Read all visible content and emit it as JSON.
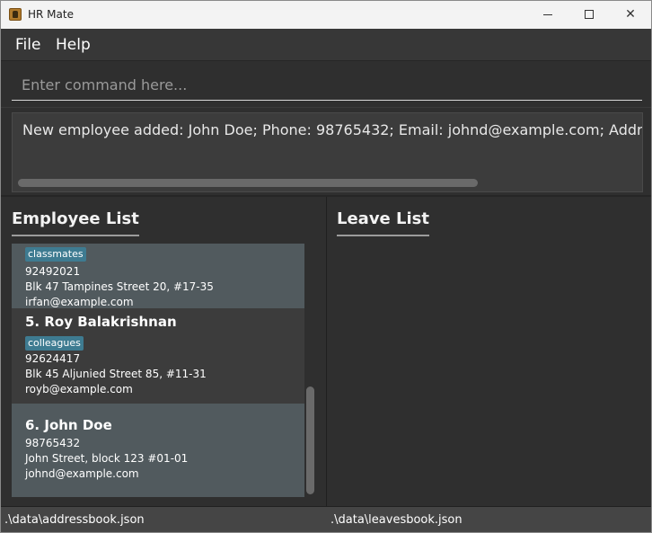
{
  "window": {
    "title": "HR Mate"
  },
  "menu": {
    "file": "File",
    "help": "Help"
  },
  "command": {
    "placeholder": "Enter command here...",
    "value": ""
  },
  "result": {
    "text": "New employee added: John Doe; Phone: 98765432; Email: johnd@example.com; Address: John"
  },
  "employee_list": {
    "title": "Employee List",
    "items": [
      {
        "name": "",
        "tag": "classmates",
        "phone": "92492021",
        "address": "Blk 47 Tampines Street 20, #17-35",
        "email": "irfan@example.com"
      },
      {
        "name": "5.  Roy Balakrishnan",
        "tag": "colleagues",
        "phone": "92624417",
        "address": "Blk 45 Aljunied Street 85, #11-31",
        "email": "royb@example.com"
      },
      {
        "name": "6.  John Doe",
        "tag": "",
        "phone": "98765432",
        "address": "John Street, block 123 #01-01",
        "email": "johnd@example.com"
      }
    ]
  },
  "leave_list": {
    "title": "Leave List"
  },
  "status": {
    "left": ".\\data\\addressbook.json",
    "right": ".\\data\\leavesbook.json"
  },
  "colors": {
    "accent_tag": "#3e7b91",
    "selected_card": "#515a5e",
    "background": "#2f2f2f"
  }
}
